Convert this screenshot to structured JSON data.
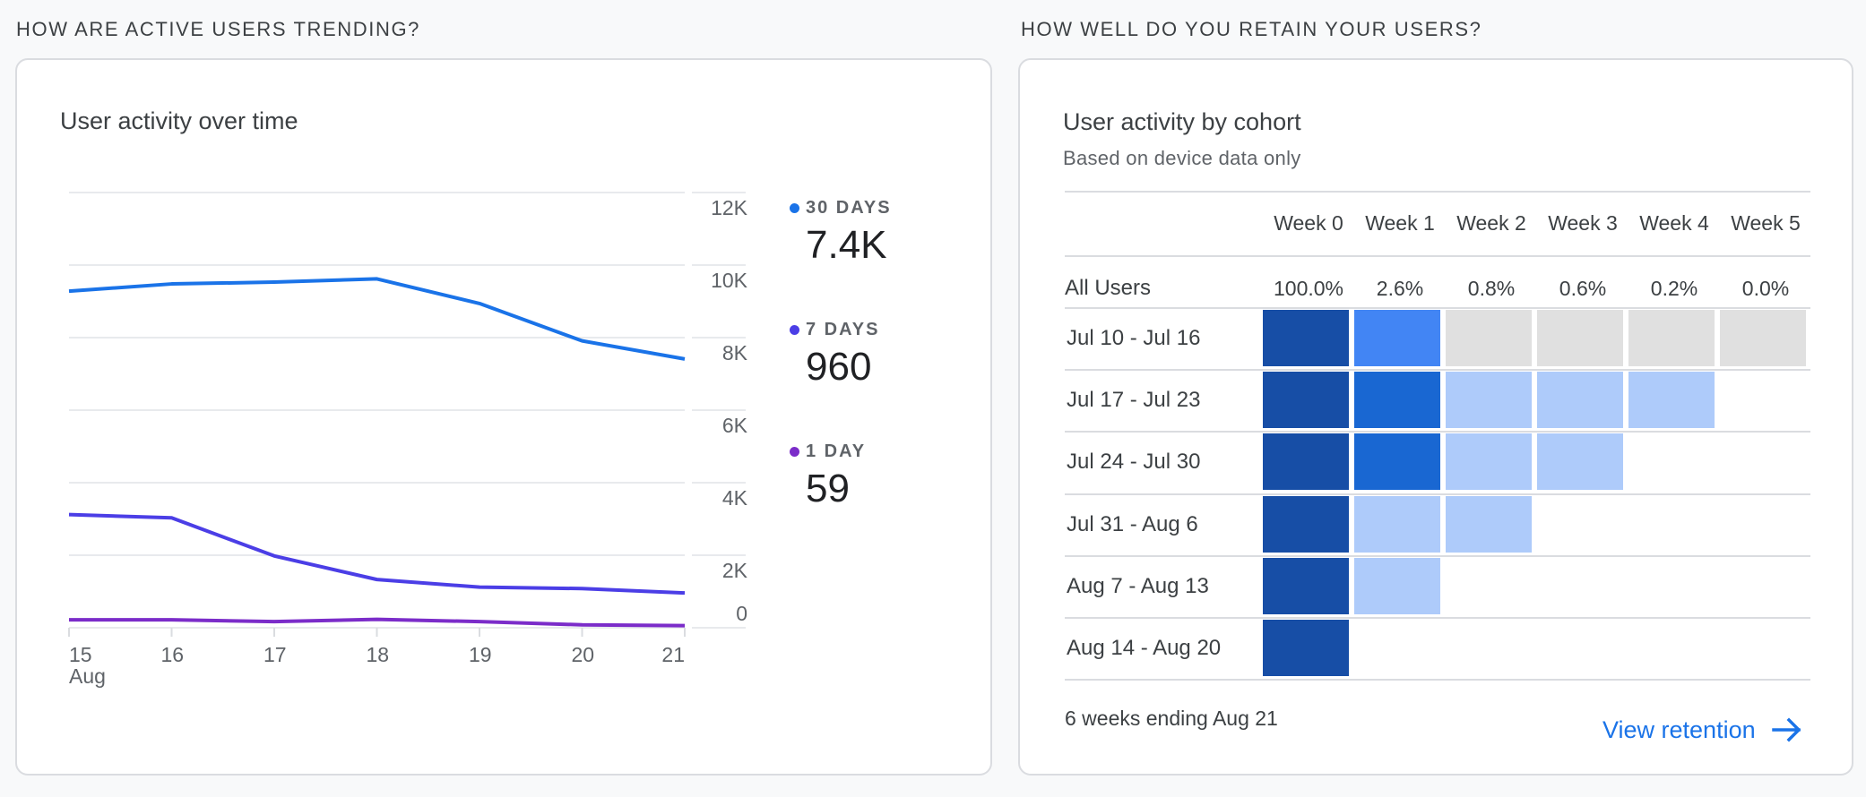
{
  "sections": {
    "left_heading": "HOW ARE ACTIVE USERS TRENDING?",
    "right_heading": "HOW WELL DO YOU RETAIN YOUR USERS?"
  },
  "activity_card": {
    "title": "User activity over time",
    "legend": [
      {
        "label": "30 DAYS",
        "value": "7.4K",
        "color": "#1a73e8"
      },
      {
        "label": "7 DAYS",
        "value": "960",
        "color": "#4b3ee6"
      },
      {
        "label": "1 DAY",
        "value": "59",
        "color": "#7b2cc9"
      }
    ]
  },
  "chart_data": {
    "type": "line",
    "title": "User activity over time",
    "x": [
      "15",
      "16",
      "17",
      "18",
      "19",
      "20",
      "21"
    ],
    "x_sublabel": "Aug",
    "xlabel": "",
    "ylabel": "",
    "ylim": [
      0,
      12000
    ],
    "yticks": [
      0,
      2000,
      4000,
      6000,
      8000,
      10000,
      12000
    ],
    "ytick_labels": [
      "0",
      "2K",
      "4K",
      "6K",
      "8K",
      "10K",
      "12K"
    ],
    "grid": true,
    "y_axis_side": "right",
    "legend_position": "right",
    "series": [
      {
        "name": "30 DAYS",
        "color": "#1a73e8",
        "values": [
          9280,
          9480,
          9530,
          9620,
          8940,
          7910,
          7410
        ]
      },
      {
        "name": "7 DAYS",
        "color": "#4b3ee6",
        "values": [
          3120,
          3030,
          1980,
          1330,
          1120,
          1080,
          960
        ]
      },
      {
        "name": "1 DAY",
        "color": "#7b2cc9",
        "values": [
          220,
          220,
          170,
          230,
          170,
          80,
          59
        ]
      }
    ]
  },
  "cohort_card": {
    "title": "User activity by cohort",
    "subtitle": "Based on device data only",
    "columns": [
      "Week 0",
      "Week 1",
      "Week 2",
      "Week 3",
      "Week 4",
      "Week 5"
    ],
    "all_users_label": "All Users",
    "all_users_values": [
      "100.0%",
      "2.6%",
      "0.8%",
      "0.6%",
      "0.2%",
      "0.0%"
    ],
    "rows": [
      {
        "label": "Jul 10 - Jul 16",
        "cells": [
          "#174ea6",
          "#4285f4",
          "#e0e0e0",
          "#e0e0e0",
          "#e0e0e0",
          "#e0e0e0"
        ]
      },
      {
        "label": "Jul 17 - Jul 23",
        "cells": [
          "#174ea6",
          "#1967d2",
          "#aecbfa",
          "#aecbfa",
          "#aecbfa"
        ]
      },
      {
        "label": "Jul 24 - Jul 30",
        "cells": [
          "#174ea6",
          "#1967d2",
          "#aecbfa",
          "#aecbfa"
        ]
      },
      {
        "label": "Jul 31 - Aug 6",
        "cells": [
          "#174ea6",
          "#aecbfa",
          "#aecbfa"
        ]
      },
      {
        "label": "Aug 7 - Aug 13",
        "cells": [
          "#174ea6",
          "#aecbfa"
        ]
      },
      {
        "label": "Aug 14 - Aug 20",
        "cells": [
          "#174ea6"
        ]
      }
    ],
    "footer": "6 weeks ending Aug 21",
    "link_label": "View retention",
    "link_color": "#1a73e8"
  }
}
